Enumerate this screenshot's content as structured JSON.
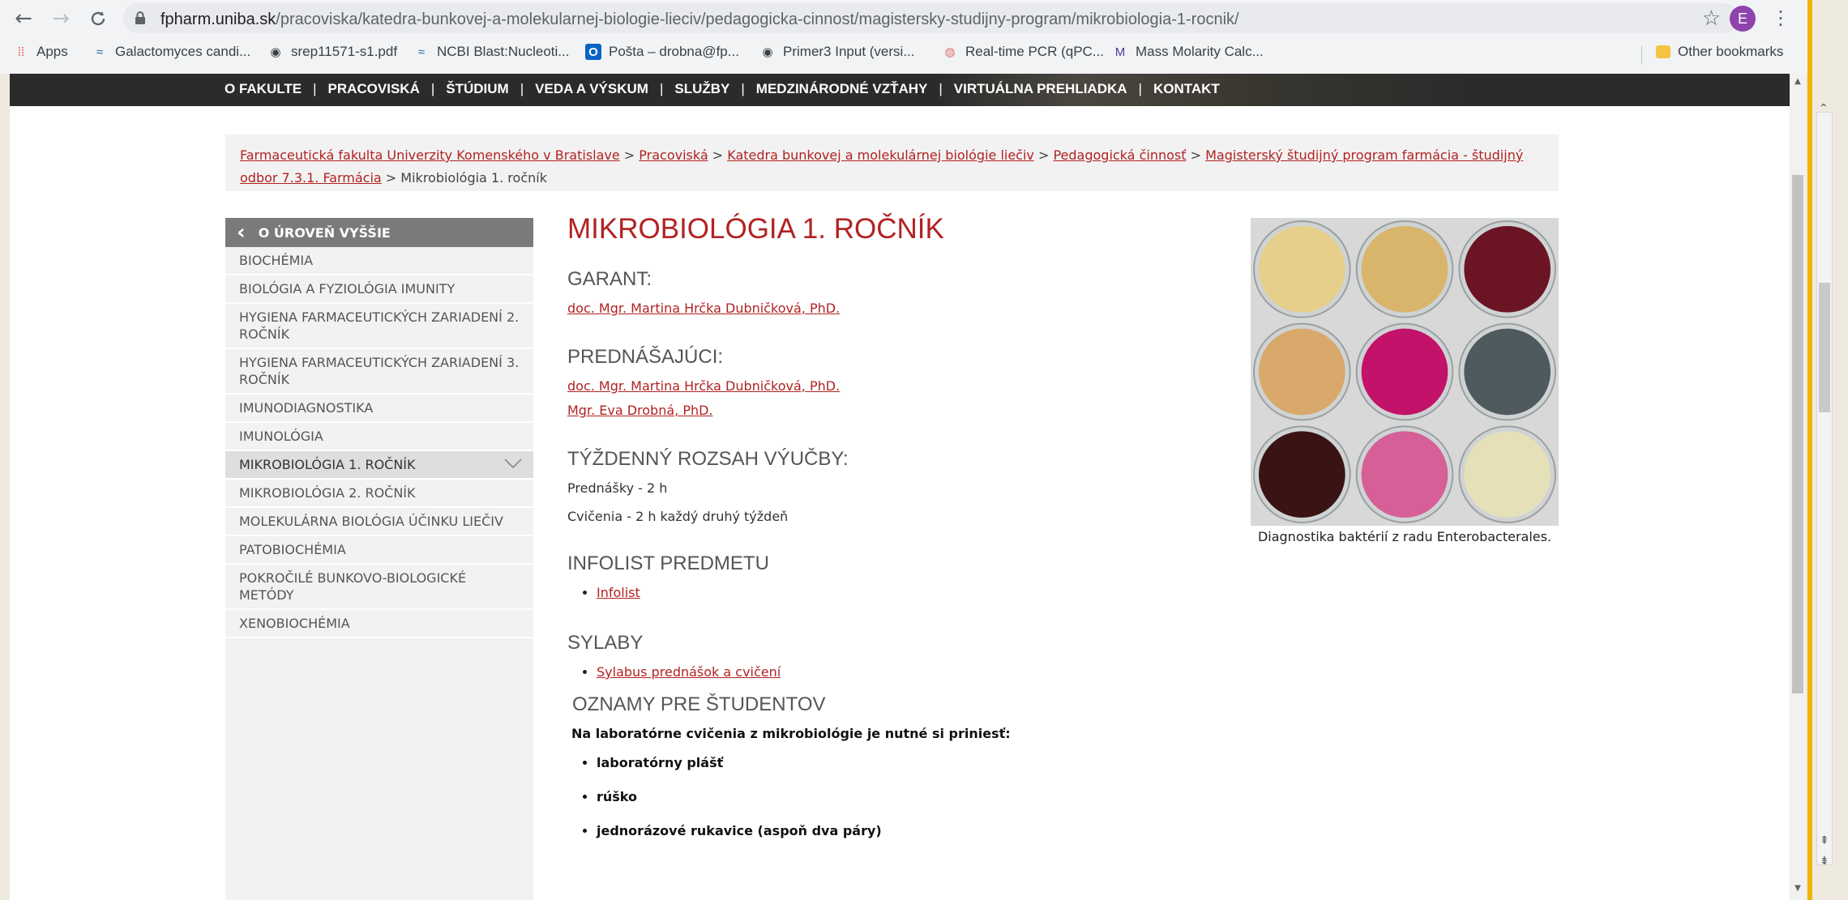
{
  "browser": {
    "url_host": "fpharm.uniba.sk",
    "url_path": "/pracoviska/katedra-bunkovej-a-molekularnej-biologie-lieciv/pedagogicka-cinnost/magistersky-studijny-program/mikrobiologia-1-rocnik/",
    "profile_initial": "E",
    "bookmarks": [
      {
        "label": "Apps",
        "icon": "apps-grid-icon"
      },
      {
        "label": "Galactomyces candi...",
        "icon": "ncbi-icon"
      },
      {
        "label": "srep11571-s1.pdf",
        "icon": "globe-icon"
      },
      {
        "label": "NCBI Blast:Nucleoti...",
        "icon": "ncbi-icon"
      },
      {
        "label": "Pošta – drobna@fp...",
        "icon": "outlook-icon"
      },
      {
        "label": "Primer3 Input (versi...",
        "icon": "globe-icon"
      },
      {
        "label": "Real-time PCR (qPC...",
        "icon": "pcr-icon"
      },
      {
        "label": "Mass Molarity Calc...",
        "icon": "sigma-m-icon"
      }
    ],
    "other_bookmarks": "Other bookmarks"
  },
  "topnav": [
    "O FAKULTE",
    "PRACOVISKÁ",
    "ŠTÚDIUM",
    "VEDA A VÝSKUM",
    "SLUŽBY",
    "MEDZINÁRODNÉ VZŤAHY",
    "VIRTUÁLNA PREHLIADKA",
    "KONTAKT"
  ],
  "breadcrumb": {
    "links": [
      "Farmaceutická fakulta Univerzity Komenského v Bratislave",
      "Pracoviská",
      "Katedra bunkovej a molekulárnej biológie liečiv",
      "Pedagogická činnosť",
      "Magisterský študijný program farmácia - študijný odbor 7.3.1. Farmácia"
    ],
    "separator": " > ",
    "current": "Mikrobiológia 1. ročník"
  },
  "sidebar": {
    "back_label": "O ÚROVEŇ VYŠŠIE",
    "items": [
      "Biochémia",
      "Biológia a fyziológia imunity",
      "Hygiena farmaceutických zariadení 2. ročník",
      "Hygiena farmaceutických zariadení 3. ročník",
      "Imunodiagnostika",
      "Imunológia",
      "Mikrobiológia 1. ročník",
      "Mikrobiológia 2. ročník",
      "Molekulárna biológia účinku liečiv",
      "Patobiochémia",
      "Pokročilé bunkovo-biologické metódy",
      "Xenobiochémia"
    ],
    "active_index": 6
  },
  "main": {
    "title": "MIKROBIOLÓGIA 1. ROČNÍK",
    "garant_heading": "GARANT:",
    "garant": "doc. Mgr. Martina Hrčka Dubničková, PhD.",
    "lecturers_heading": "PREDNÁŠAJÚCI:",
    "lecturers": [
      "doc. Mgr. Martina Hrčka Dubničková, PhD.",
      "Mgr. Eva Drobná, PhD."
    ],
    "scope_heading": "TÝŽDENNÝ ROZSAH VÝUČBY:",
    "scope": [
      "Prednášky - 2 h",
      "Cvičenia -  2 h každý druhý týždeň"
    ],
    "infolist_heading": "INFOLIST PREDMETU",
    "infolist_link": "Infolist",
    "syllabus_heading": "SYLABY",
    "syllabus_link": "Sylabus prednášok a cvičení",
    "notice_heading": "OZNAMY PRE ŠTUDENTOV",
    "notice_text": "Na laboratórne cvičenia z mikrobiológie je nutné si priniesť:",
    "notice_items": [
      "laboratórny plášť",
      "rúško",
      "jednorázové rukavice (aspoň dva páry)"
    ]
  },
  "figure": {
    "caption": "Diagnostika baktérií z radu Enterobacterales.",
    "plate_colors": [
      "#e6cf8a",
      "#d9b46b",
      "#6b1424",
      "#d8a96a",
      "#c2126a",
      "#4f5a5e",
      "#3a1414",
      "#d65f97",
      "#e5e0b8"
    ],
    "background": "#d8d8d8"
  },
  "colors": {
    "accent": "#b22222",
    "sidebar_bg": "#f2f2f2",
    "sidebar_head": "#7a7a7a",
    "topnav_bg": "#2b2b2b"
  }
}
